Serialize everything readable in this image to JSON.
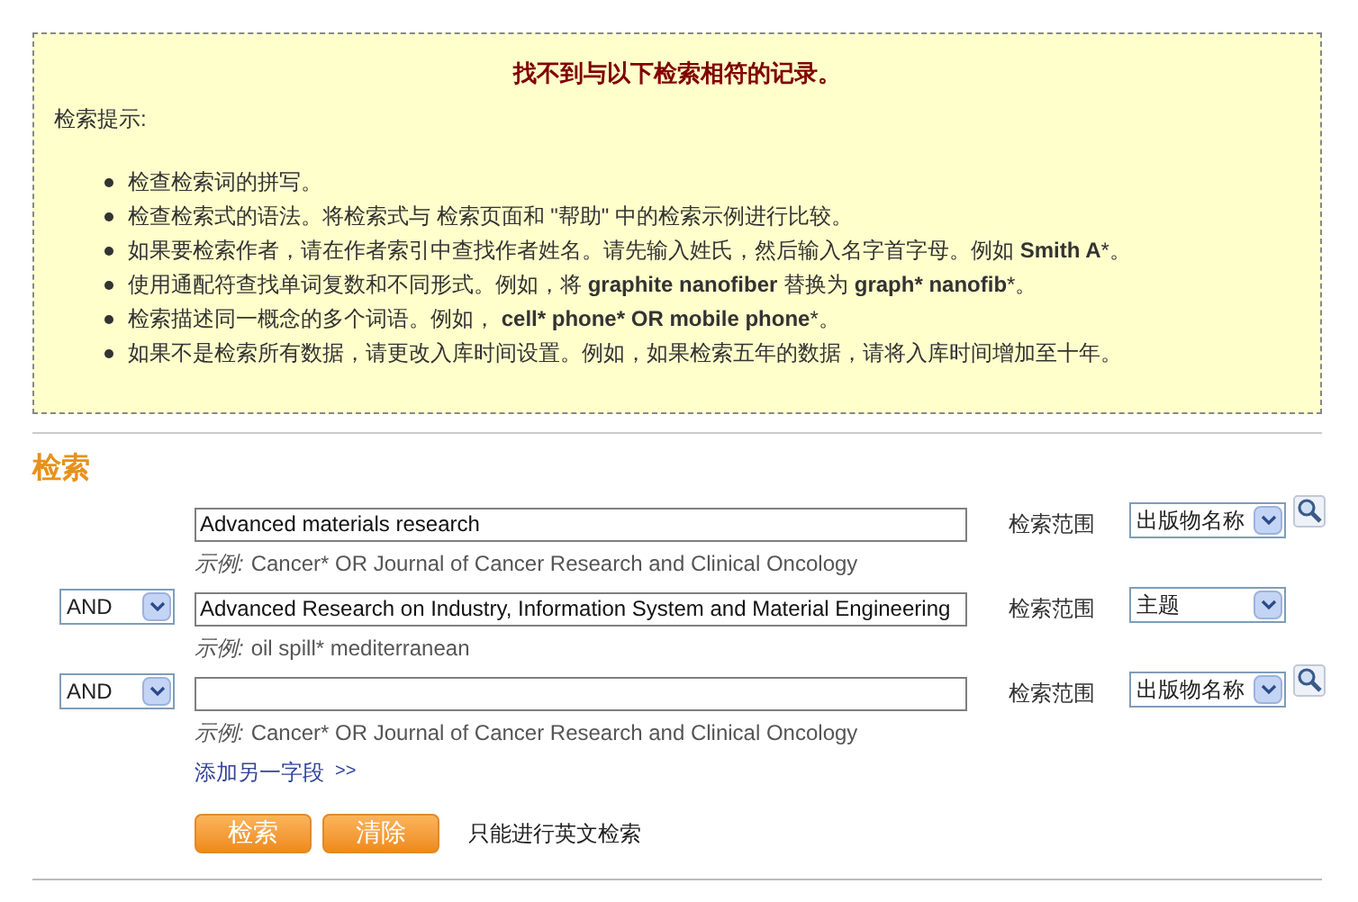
{
  "notice": {
    "title": "找不到与以下检索相符的记录。",
    "tips_label": "检索提示:",
    "tips": [
      "检查检索词的拼写。",
      "检查检索式的语法。将检索式与 检索页面和 \"帮助\" 中的检索示例进行比较。",
      "如果要检索作者，请在作者索引中查找作者姓名。请先输入姓氏，然后输入名字首字母。例如 **Smith A***。",
      "使用通配符查找单词复数和不同形式。例如，将 **graphite nanofiber** 替换为 **graph* nanofib***。",
      "检索描述同一概念的多个词语。例如， **cell* phone* OR mobile phone***。",
      "如果不是检索所有数据，请更改入库时间设置。例如，如果检索五年的数据，请将入库时间增加至十年。"
    ]
  },
  "search": {
    "heading": "检索",
    "rows": [
      {
        "value": "Advanced materials research",
        "example_label": "示例:",
        "example": "Cancer* OR Journal of Cancer Research and Clinical Oncology",
        "scope_label": "检索范围",
        "scope": "出版物名称",
        "lookup": true
      },
      {
        "operator": "AND",
        "value": "Advanced Research on Industry, Information System and Material Engineering",
        "example_label": "示例:",
        "example": "oil spill* mediterranean",
        "scope_label": "检索范围",
        "scope": "主题",
        "lookup": false
      },
      {
        "operator": "AND",
        "example_label": "示例:",
        "example": "Cancer* OR Journal of Cancer Research and Clinical Oncology",
        "scope_label": "检索范围",
        "scope": "出版物名称",
        "lookup": true
      }
    ],
    "add_field": "添加另一字段",
    "add_arrows": ">>",
    "buttons": [
      "检索",
      "清除"
    ],
    "note": "只能进行英文检索"
  }
}
